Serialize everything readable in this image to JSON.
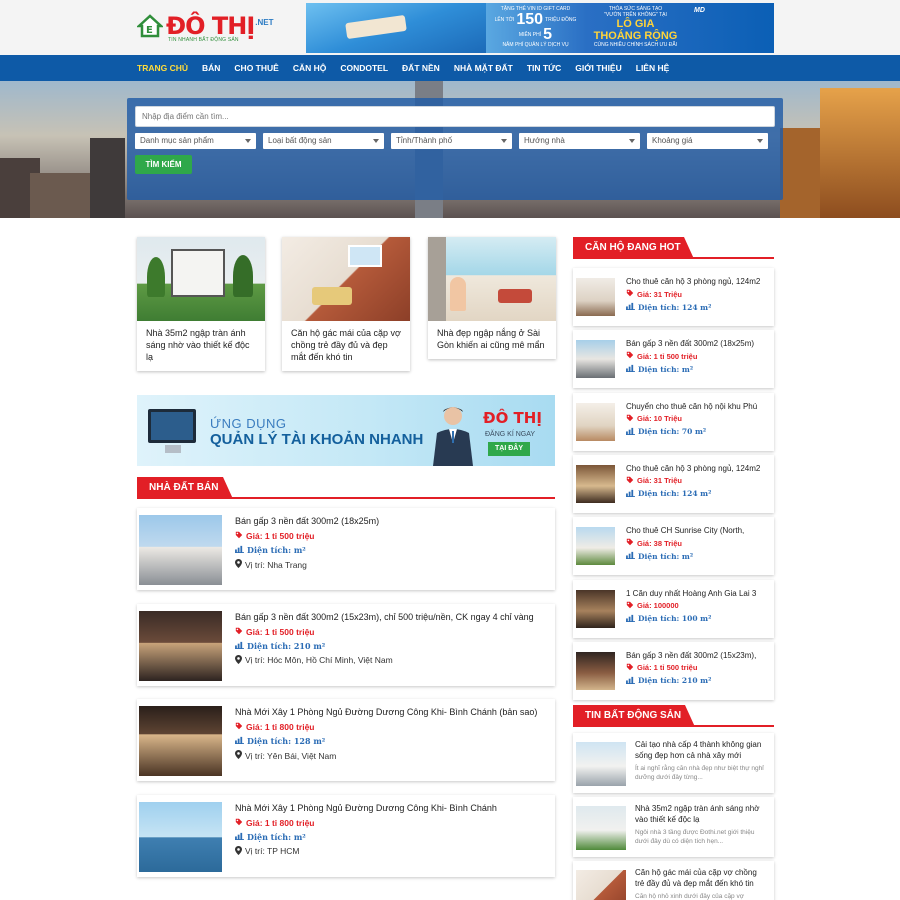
{
  "header": {
    "logo_text": "ĐÔ THỊ",
    "logo_suffix": ".NET",
    "logo_tagline": "TIN NHANH BẤT ĐỘNG SẢN",
    "banner": {
      "line1": "TẶNG THẺ VIN ID GIFT CARD",
      "line2": "LÊN TỚI",
      "amount": "150",
      "line3": "TRIỆU ĐỒNG",
      "line4": "MIỄN PHÍ",
      "years": "5",
      "line5": "NĂM PHÍ QUẢN LÝ DỊCH VỤ",
      "right1": "THỎA SỨC SÁNG TẠO",
      "right2": "\"VƯỜN TRÊN KHÔNG\" TẠI",
      "right3": "LÔ GIA",
      "right4": "THOÁNG RỘNG",
      "right5": "CÙNG NHIỀU CHÍNH SÁCH ƯU ĐÃI",
      "brand": "MD"
    }
  },
  "nav": [
    "TRANG CHỦ",
    "BÁN",
    "CHO THUÊ",
    "CĂN HỘ",
    "CONDOTEL",
    "ĐẤT NỀN",
    "NHÀ MẶT ĐẤT",
    "TIN TỨC",
    "GIỚI THIỆU",
    "LIÊN HỆ"
  ],
  "search": {
    "placeholder": "Nhập địa điểm cần tìm...",
    "selects": [
      "Danh mục sản phẩm",
      "Loại bất động sản",
      "Tỉnh/Thành phố",
      "Hướng nhà",
      "Khoảng giá"
    ],
    "button": "TÌM KIẾM"
  },
  "featured": [
    "Nhà 35m2 ngập tràn ánh sáng nhờ vào thiết kế độc lạ",
    "Căn hộ gác mái của cặp vợ chồng trẻ đầy đủ và đẹp mắt đến khó tin",
    "Nhà đẹp ngập nắng ở Sài Gòn khiến ai cũng mê mẩn"
  ],
  "app_banner": {
    "line1": "ỨNG DỤNG",
    "line2": "QUẢN LÝ TÀI KHOẢN NHANH",
    "logo": "ĐÔ THỊ",
    "register": "ĐĂNG KÍ NGAY",
    "cta": "TẠI ĐÂY"
  },
  "sections": {
    "sale": "NHÀ ĐẤT BÁN",
    "hot": "CĂN HỘ ĐANG HOT",
    "news": "TIN BẤT ĐỘNG SẢN"
  },
  "listings": [
    {
      "title": "Bán gấp 3 nền đất 300m2 (18x25m)",
      "price": "Giá: 1 tỉ 500 triệu",
      "area": "Diện tích: m²",
      "location": "Vị trí: Nha Trang"
    },
    {
      "title": "Bán gấp 3 nền đất 300m2 (15x23m), chỉ 500 triệu/nền, CK ngay 4 chỉ vàng",
      "price": "Giá: 1 tỉ 500 triệu",
      "area": "Diện tích: 210 m²",
      "location": "Vị trí: Hóc Môn, Hồ Chí Minh, Việt Nam"
    },
    {
      "title": "Nhà Mới Xây 1 Phòng Ngủ Đường Dương Công Khi- Bình Chánh (bản sao)",
      "price": "Giá: 1 tỉ 800 triệu",
      "area": "Diện tích: 128 m²",
      "location": "Vị trí: Yên Bái, Việt Nam"
    },
    {
      "title": "Nhà Mới Xây 1 Phòng Ngủ Đường Dương Công Khi- Bình Chánh",
      "price": "Giá: 1 tỉ 800 triệu",
      "area": "Diện tích: m²",
      "location": "Vị trí: TP HCM"
    }
  ],
  "hot": [
    {
      "title": "Cho thuê căn hộ 3 phòng ngủ, 124m2",
      "price": "Giá: 31 Triệu",
      "area": "Diện tích: 124 m²"
    },
    {
      "title": "Bán gấp 3 nền đất 300m2 (18x25m)",
      "price": "Giá: 1 tỉ 500 triệu",
      "area": "Diện tích: m²"
    },
    {
      "title": "Chuyển cho thuê căn hộ nội khu Phú",
      "price": "Giá: 10 Triệu",
      "area": "Diện tích: 70 m²"
    },
    {
      "title": "Cho thuê căn hộ 3 phòng ngủ, 124m2",
      "price": "Giá: 31 Triệu",
      "area": "Diện tích: 124 m²"
    },
    {
      "title": "Cho thuê CH Sunrise City (North,",
      "price": "Giá: 38 Triệu",
      "area": "Diện tích: m²"
    },
    {
      "title": "1 Căn duy nhất Hoàng Anh Gia Lai 3",
      "price": "Giá: 100000",
      "area": "Diện tích: 100 m²"
    },
    {
      "title": "Bán gấp 3 nền đất 300m2 (15x23m),",
      "price": "Giá: 1 tỉ 500 triệu",
      "area": "Diện tích: 210 m²"
    }
  ],
  "news": [
    {
      "title": "Cải tạo nhà cấp 4 thành không gian sống đẹp hơn cả nhà xây mới",
      "desc": "Ít ai nghĩ rằng căn nhà đẹp như biệt thự nghỉ dưỡng dưới đây từng..."
    },
    {
      "title": "Nhà 35m2 ngập tràn ánh sáng nhờ vào thiết kế độc lạ",
      "desc": "Ngôi nhà 3 tầng được Đothi.net giới thiệu dưới đây dù có diện tích hẹn..."
    },
    {
      "title": "Căn hộ gác mái của cặp vợ chồng trẻ đầy đủ và đẹp mắt đến khó tin",
      "desc": "Căn hộ nhỏ xinh dưới đây của cặp vợ"
    }
  ],
  "colors": {
    "nav": "#0e5aa7",
    "accent": "#e21f26",
    "green": "#2fa84a",
    "active_nav": "#ffdc3b"
  }
}
